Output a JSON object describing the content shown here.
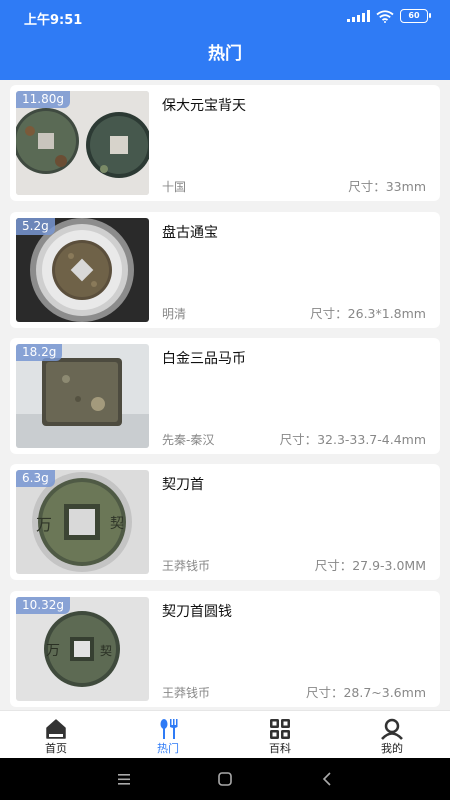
{
  "status": {
    "time": "上午9:51",
    "battery": "60"
  },
  "header": {
    "title": "热门"
  },
  "items": [
    {
      "weight": "11.80g",
      "name": "保大元宝背天",
      "era": "十国",
      "size": "尺寸：33mm"
    },
    {
      "weight": "5.2g",
      "name": "盘古通宝",
      "era": "明清",
      "size": "尺寸：26.3*1.8mm"
    },
    {
      "weight": "18.2g",
      "name": "白金三品马币",
      "era": "先秦-秦汉",
      "size": "尺寸：32.3-33.7-4.4mm"
    },
    {
      "weight": "6.3g",
      "name": "契刀首",
      "era": "王莽钱币",
      "size": "尺寸：27.9-3.0MM"
    },
    {
      "weight": "10.32g",
      "name": "契刀首圆钱",
      "era": "王莽钱币",
      "size": "尺寸：28.7~3.6mm"
    }
  ],
  "tabs": [
    {
      "label": "首页",
      "icon": "home-icon"
    },
    {
      "label": "热门",
      "icon": "fork-spoon-icon",
      "active": true
    },
    {
      "label": "百科",
      "icon": "grid-icon"
    },
    {
      "label": "我的",
      "icon": "user-icon"
    }
  ],
  "colors": {
    "primary": "#2f7bf5",
    "background": "#f2f2f2"
  }
}
